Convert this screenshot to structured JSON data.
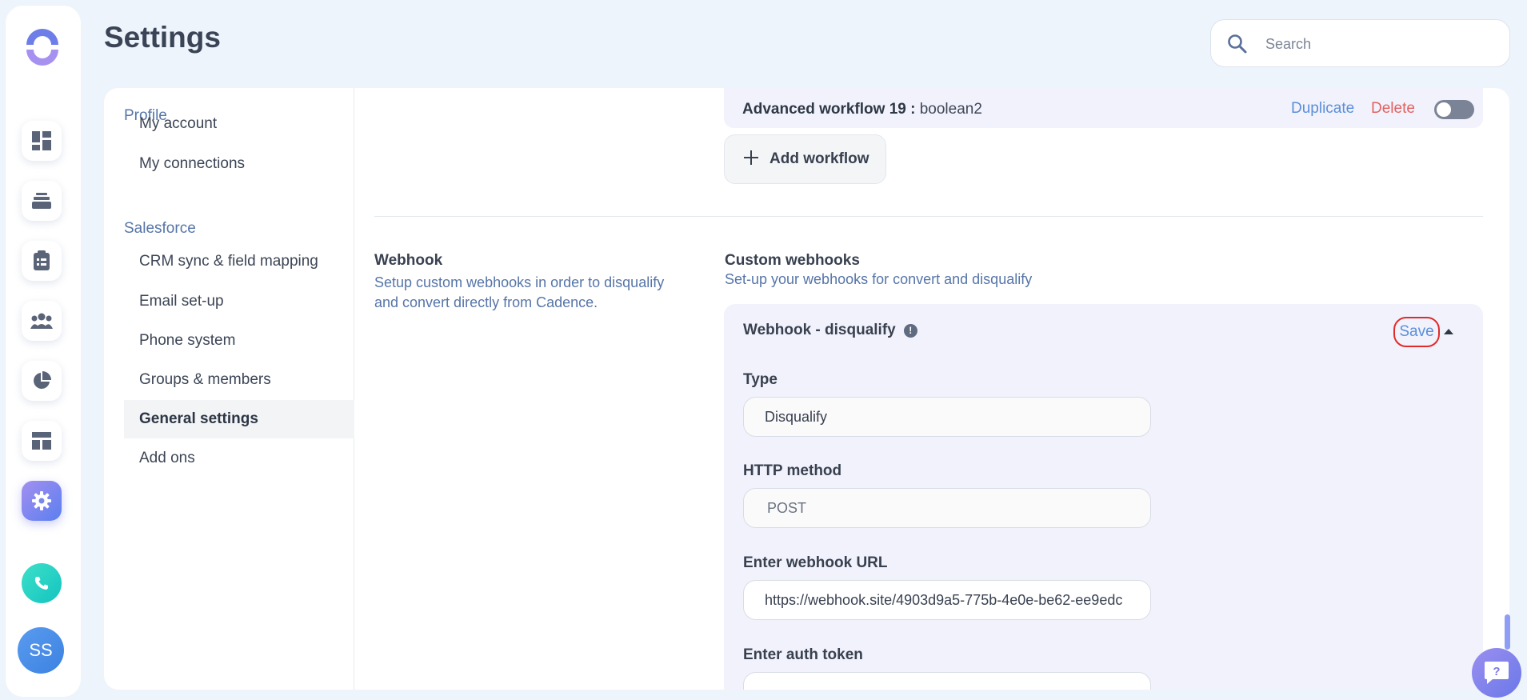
{
  "page": {
    "title": "Settings"
  },
  "search": {
    "placeholder": "Search"
  },
  "rail": {
    "icons": [
      "dashboard-icon",
      "stack-icon",
      "clipboard-icon",
      "people-icon",
      "pie-chart-icon",
      "layout-icon",
      "gear-icon"
    ],
    "phone_icon": "phone-icon",
    "avatar_initials": "SS"
  },
  "sidenav": {
    "sections": [
      {
        "title": "Profile",
        "items": [
          "My account",
          "My connections"
        ]
      },
      {
        "title": "Salesforce",
        "items": [
          "CRM sync & field mapping",
          "Email set-up",
          "Phone system",
          "Groups & members",
          "General settings",
          "Add ons"
        ]
      }
    ],
    "active_item": "General settings"
  },
  "workflow": {
    "title_label": "Advanced workflow 19 :",
    "title_value": "boolean2",
    "duplicate_label": "Duplicate",
    "delete_label": "Delete",
    "toggle_on": false,
    "add_label": "Add workflow"
  },
  "webhook_section": {
    "title": "Webhook",
    "description": "Setup custom webhooks in order to disqualify and convert directly from Cadence.",
    "custom_title": "Custom webhooks",
    "custom_description": "Set-up your webhooks for convert and disqualify"
  },
  "webhook_card": {
    "title": "Webhook - disqualify",
    "info_icon": "!",
    "save_label": "Save",
    "type_label": "Type",
    "type_value": "Disqualify",
    "method_label": "HTTP method",
    "method_value": "POST",
    "url_label": "Enter webhook URL",
    "url_value": "https://webhook.site/4903d9a5-775b-4e0e-be62-ee9edc",
    "auth_label": "Enter auth token"
  },
  "colors": {
    "accent": "#5b8fd8",
    "danger": "#e36161",
    "card_bg": "#f1f2fc",
    "section_title": "#5675a8"
  }
}
